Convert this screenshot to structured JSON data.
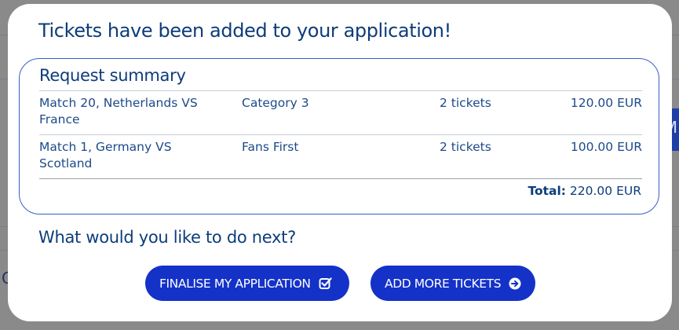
{
  "modal": {
    "title": "Tickets have been added to your application!"
  },
  "summary": {
    "title": "Request summary",
    "items": [
      {
        "match": "Match 20, Netherlands VS France",
        "category": "Category 3",
        "quantity": "2 tickets",
        "price": "120.00 EUR"
      },
      {
        "match": "Match 1, Germany VS Scotland",
        "category": "Fans First",
        "quantity": "2 tickets",
        "price": "100.00 EUR"
      }
    ],
    "total_label": "Total:",
    "total_value": "220.00 EUR"
  },
  "next": {
    "heading": "What would you like to do next?",
    "finalise_label": "FINALISE MY APPLICATION",
    "finalise_icon": "checkbox-check-icon",
    "add_more_label": "ADD MORE TICKETS",
    "add_more_icon": "circle-arrow-right-icon"
  },
  "background": {
    "right_tab_letter": "M",
    "left_letter": "C"
  },
  "colors": {
    "heading": "#0d3c7a",
    "text": "#1c4a8a",
    "accent": "#1432c8",
    "border": "#3a5fc4",
    "overlay": "#8a8a8a"
  }
}
